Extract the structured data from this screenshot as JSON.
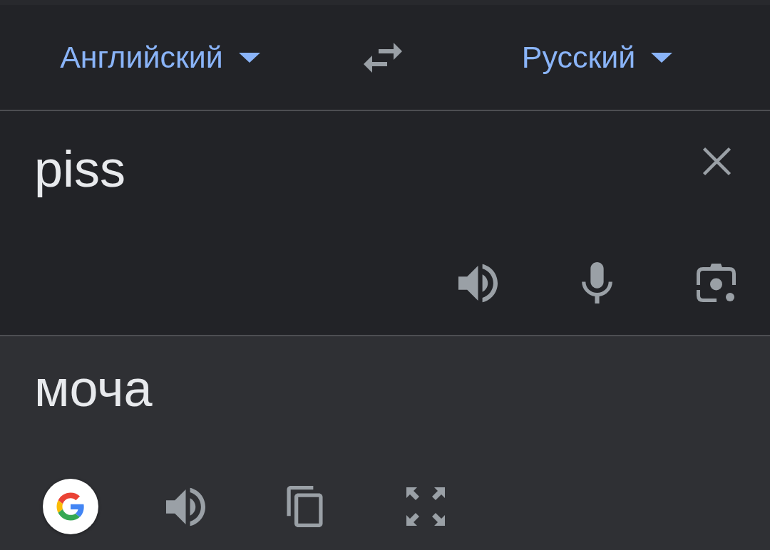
{
  "header": {
    "source_language": "Английский",
    "target_language": "Русский"
  },
  "input": {
    "value": "piss"
  },
  "output": {
    "translation": "моча"
  }
}
